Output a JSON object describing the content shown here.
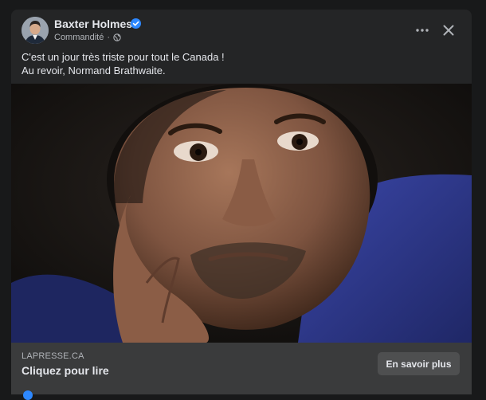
{
  "post": {
    "author": "Baxter Holmes",
    "sponsored_label": "Commandité",
    "meta_separator": "·",
    "text_lines": [
      "C'est un jour très triste pour tout le Canada !",
      "Au revoir, Normand Brathwaite."
    ]
  },
  "link": {
    "domain": "LAPRESSE.CA",
    "title": "Cliquez pour lire",
    "cta_label": "En savoir plus"
  },
  "icons": {
    "verified": "verified-badge-icon",
    "privacy": "globe-icon",
    "more": "more-options-icon",
    "close": "close-icon"
  },
  "colors": {
    "page_bg": "#18191a",
    "card_bg": "#242526",
    "link_bar_bg": "#3a3b3c",
    "cta_bg": "#4e4f50",
    "verified_blue": "#2d88ff",
    "primary_text": "#e4e6eb",
    "secondary_text": "#b0b3b8"
  }
}
